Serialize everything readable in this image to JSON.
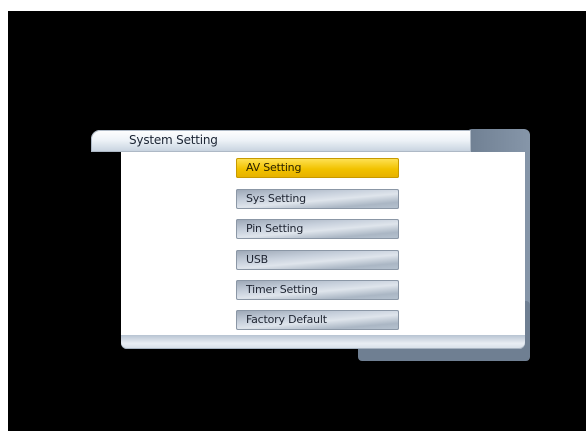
{
  "title": "System Setting",
  "menu": {
    "items": [
      {
        "label": "AV Setting",
        "selected": true
      },
      {
        "label": "Sys Setting",
        "selected": false
      },
      {
        "label": "Pin Setting",
        "selected": false
      },
      {
        "label": "USB",
        "selected": false
      },
      {
        "label": "Timer Setting",
        "selected": false
      },
      {
        "label": "Factory Default",
        "selected": false
      }
    ]
  },
  "colors": {
    "background": "#000000",
    "selected": "#f2c200",
    "item": "#c7d0dc",
    "panel_back": "#7a8a9c"
  }
}
